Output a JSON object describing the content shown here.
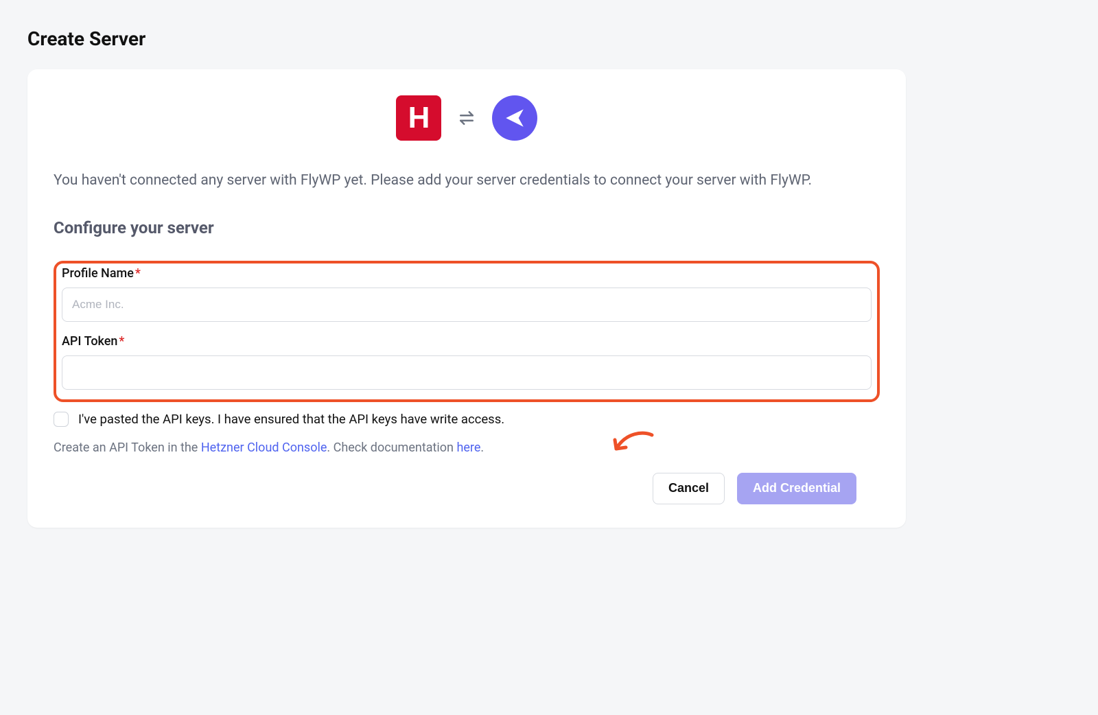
{
  "page_title": "Create Server",
  "intro": "You haven't connected any server with FlyWP yet. Please add your server credentials to connect your server with FlyWP.",
  "section_heading": "Configure your server",
  "fields": {
    "profile_name": {
      "label": "Profile Name",
      "placeholder": "Acme Inc.",
      "value": ""
    },
    "api_token": {
      "label": "API Token",
      "placeholder": "",
      "value": ""
    }
  },
  "checkbox_label": "I've pasted the API keys. I have ensured that the API keys have write access.",
  "help": {
    "prefix": "Create an API Token in the ",
    "link1": "Hetzner Cloud Console",
    "mid": ". Check documentation ",
    "link2": "here",
    "suffix": "."
  },
  "buttons": {
    "cancel": "Cancel",
    "submit": "Add Credential"
  },
  "icons": {
    "hetzner_letter": "H"
  }
}
